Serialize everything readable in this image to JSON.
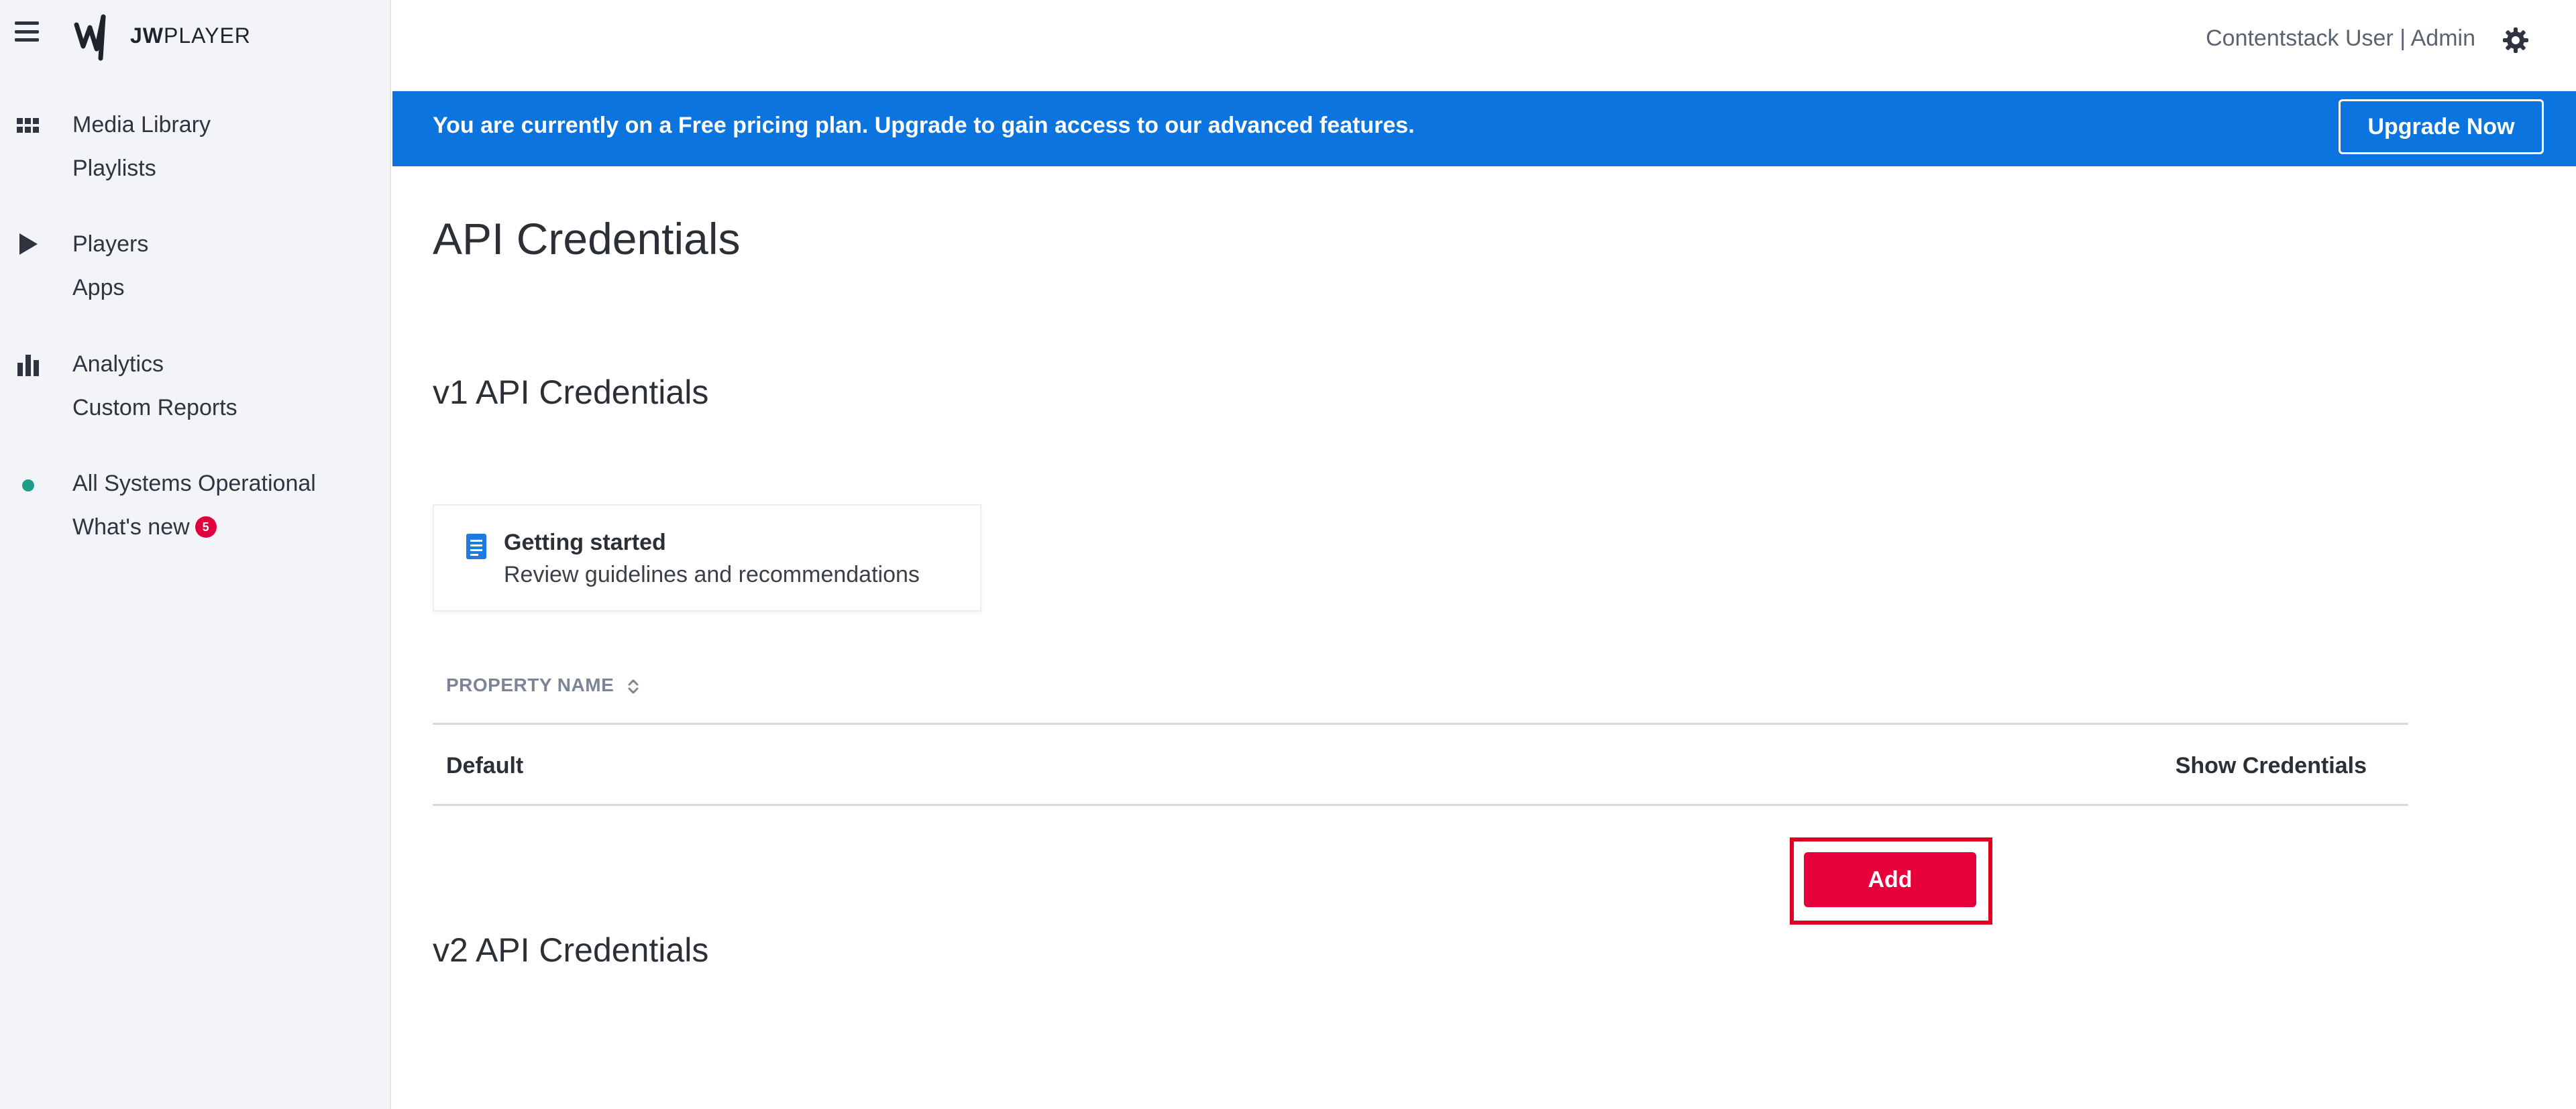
{
  "app": {
    "logo_text_bold": "JW",
    "logo_text_rest": "PLAYER"
  },
  "sidebar": {
    "groups": [
      {
        "icon": "grid-icon",
        "items": [
          {
            "label": "Media Library"
          },
          {
            "label": "Playlists"
          }
        ]
      },
      {
        "icon": "play-icon",
        "items": [
          {
            "label": "Players"
          },
          {
            "label": "Apps"
          }
        ]
      },
      {
        "icon": "bar-chart-icon",
        "items": [
          {
            "label": "Analytics"
          },
          {
            "label": "Custom Reports"
          }
        ]
      },
      {
        "icon": "status-dot-icon",
        "items": [
          {
            "label": "All Systems Operational"
          },
          {
            "label": "What's new",
            "badge": "5"
          }
        ]
      }
    ]
  },
  "header": {
    "user_info": "Contentstack User | Admin"
  },
  "banner": {
    "text": "You are currently on a Free pricing plan. Upgrade to gain access to our advanced features.",
    "button_label": "Upgrade Now"
  },
  "main": {
    "page_title": "API Credentials",
    "v1_title": "v1 API Credentials",
    "card": {
      "title": "Getting started",
      "subtitle": "Review guidelines and recommendations"
    },
    "table": {
      "header": "PROPERTY NAME",
      "rows": [
        {
          "name": "Default",
          "action": "Show Credentials"
        }
      ]
    },
    "v2_title": "v2 API Credentials",
    "add_label": "Add"
  },
  "colors": {
    "banner": "#0b74de",
    "accent_red": "#e8003d",
    "status_green": "#1e9e8a"
  }
}
